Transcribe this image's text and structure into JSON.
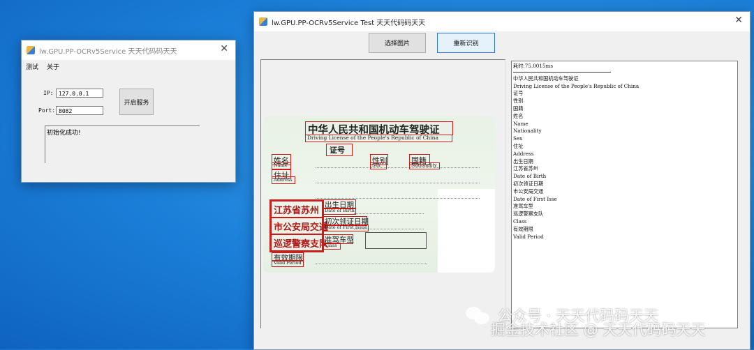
{
  "small_window": {
    "title": "lw.GPU.PP-OCRv5Service 天天代码码天天",
    "close": "✕",
    "menu": [
      "测试",
      "关于"
    ],
    "ip_label": "IP:",
    "ip_value": "127.0.0.1",
    "port_label": "Port:",
    "port_value": "8082",
    "start_button": "开启服务",
    "log_text": "初始化成功!"
  },
  "main_window": {
    "title": "lw.GPU.PP-OCRv5Service Test  天天代码码天天",
    "close": "✕",
    "select_button": "选择图片",
    "recognize_button": "重新识别",
    "result_time": "耗时:75.0015ms",
    "result_lines": [
      "中华人民共和国机动车驾驶证",
      "Driving License of the People's Republic of China",
      "证号",
      "性别",
      "国籍",
      "姓名",
      "Name",
      " Nationality",
      "Sex",
      "住址",
      "Address",
      "出生日期",
      "江苏省苏州",
      "Date of Birth",
      "初次领证日期",
      "市公安局交通",
      "Date of First Isse",
      "准驾车型",
      "巡逻警察支队",
      "Class",
      "有效期限",
      "Valid Period"
    ]
  },
  "card": {
    "title": "中华人民共和国机动车驾驶证",
    "subtitle": "Driving License of the People's Republic of China",
    "zhenghao": "证号",
    "name_cn": "姓名",
    "name_en": "Name",
    "sex_cn": "性别",
    "sex_en": "Sex",
    "nat_cn": "国籍",
    "nat_en": "Nationality",
    "addr_cn": "住址",
    "addr_en": "Address",
    "seal1": "江苏省苏州",
    "seal2": "市公安局交通",
    "seal3": "巡逻警察支队",
    "dob_cn": "出生日期",
    "dob_en": "Date of Birth",
    "first_cn": "初次领证日期",
    "first_en": "Date of First Issue",
    "class_cn": "准驾车型",
    "class_en": "Class",
    "valid_cn": "有效期限",
    "valid_en": "Valid Period"
  },
  "watermark": {
    "line1": "公众号 · 天天代码码天天",
    "line2": "掘金技术社区 @ 天天代码码天天"
  }
}
